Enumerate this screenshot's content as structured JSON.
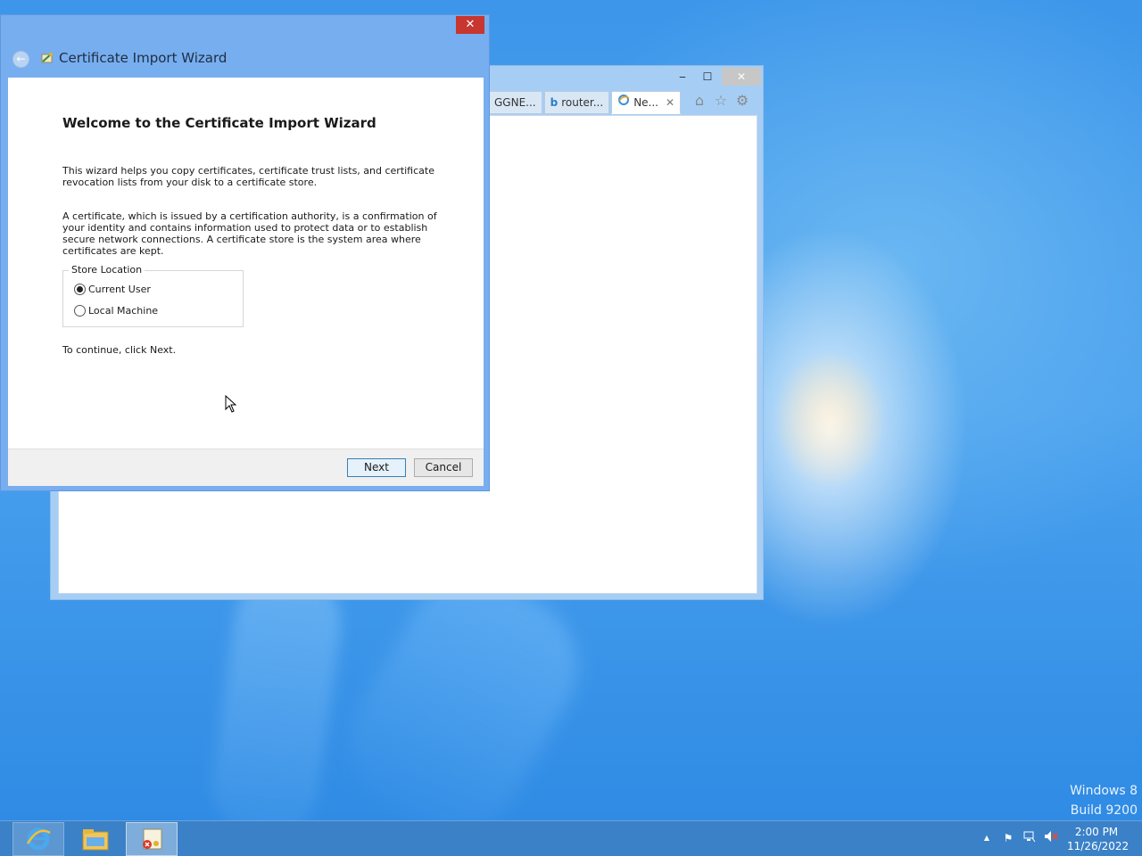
{
  "desktop": {
    "brand_line1": "Windows 8",
    "brand_line2": "Build 9200"
  },
  "ie_window": {
    "minimize_glyph": "‒",
    "maximize_glyph": "☐",
    "close_glyph": "✕",
    "tabs": [
      {
        "label": "GGNE..."
      },
      {
        "label": "router..."
      },
      {
        "label": "Ne...",
        "active": true,
        "close_glyph": "✕"
      }
    ],
    "tools": [
      "home-icon",
      "favorites-star-icon",
      "settings-gear-icon"
    ]
  },
  "wizard": {
    "title": "Certificate Import Wizard",
    "close_glyph": "✕",
    "back_glyph": "←",
    "heading": "Welcome to the Certificate Import Wizard",
    "paragraph1": "This wizard helps you copy certificates, certificate trust lists, and certificate revocation lists from your disk to a certificate store.",
    "paragraph2": "A certificate, which is issued by a certification authority, is a confirmation of your identity and contains information used to protect data or to establish secure network connections. A certificate store is the system area where certificates are kept.",
    "store_location": {
      "legend": "Store Location",
      "options": [
        {
          "label": "Current User",
          "selected": true
        },
        {
          "label": "Local Machine",
          "selected": false
        }
      ]
    },
    "continue_text": "To continue, click Next.",
    "next_label": "Next",
    "cancel_label": "Cancel"
  },
  "taskbar": {
    "apps": [
      "internet-explorer-icon",
      "file-explorer-icon",
      "certificate-icon"
    ],
    "tray_expand_glyph": "▲",
    "clock_time": "2:00 PM",
    "clock_date": "11/26/2022"
  },
  "colors": {
    "accent": "#77aeef",
    "close_red": "#c7362f",
    "taskbar": "#397fc4",
    "desktop": "#3f97e9"
  }
}
